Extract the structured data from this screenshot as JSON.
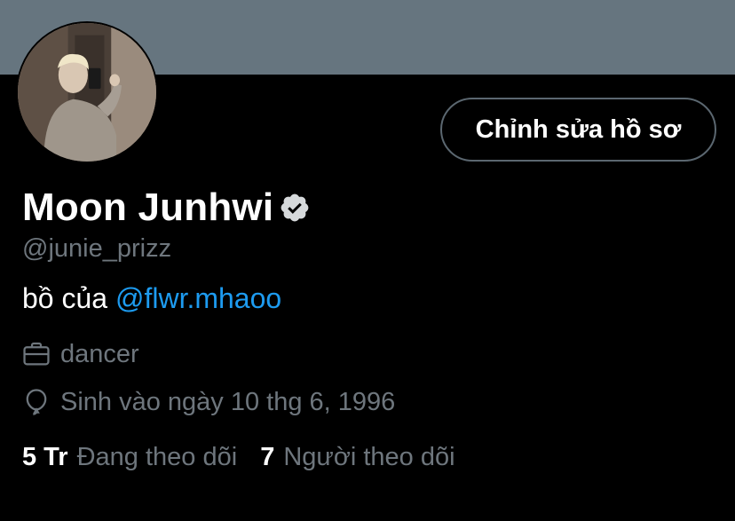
{
  "header": {
    "banner_color": "#66757f"
  },
  "profile": {
    "avatar_icon": "profile-photo",
    "edit_button_label": "Chỉnh sửa hồ sơ",
    "display_name": "Moon Junhwi",
    "verified_icon": "verified-badge-icon",
    "handle": "@junie_prizz",
    "bio_text": "bồ của ",
    "bio_mention": "@flwr.mhaoo",
    "profession_icon": "briefcase-icon",
    "profession": "dancer",
    "birth_icon": "balloon-icon",
    "birthday": "Sinh vào ngày 10 thg 6, 1996",
    "following_count": "5 Tr",
    "following_label": "Đang theo dõi",
    "followers_count": "7",
    "followers_label": "Người theo dõi"
  },
  "colors": {
    "background": "#000000",
    "text_primary": "#ffffff",
    "text_secondary": "#6e767d",
    "link": "#1d9bf0",
    "button_border": "#5b6770"
  }
}
